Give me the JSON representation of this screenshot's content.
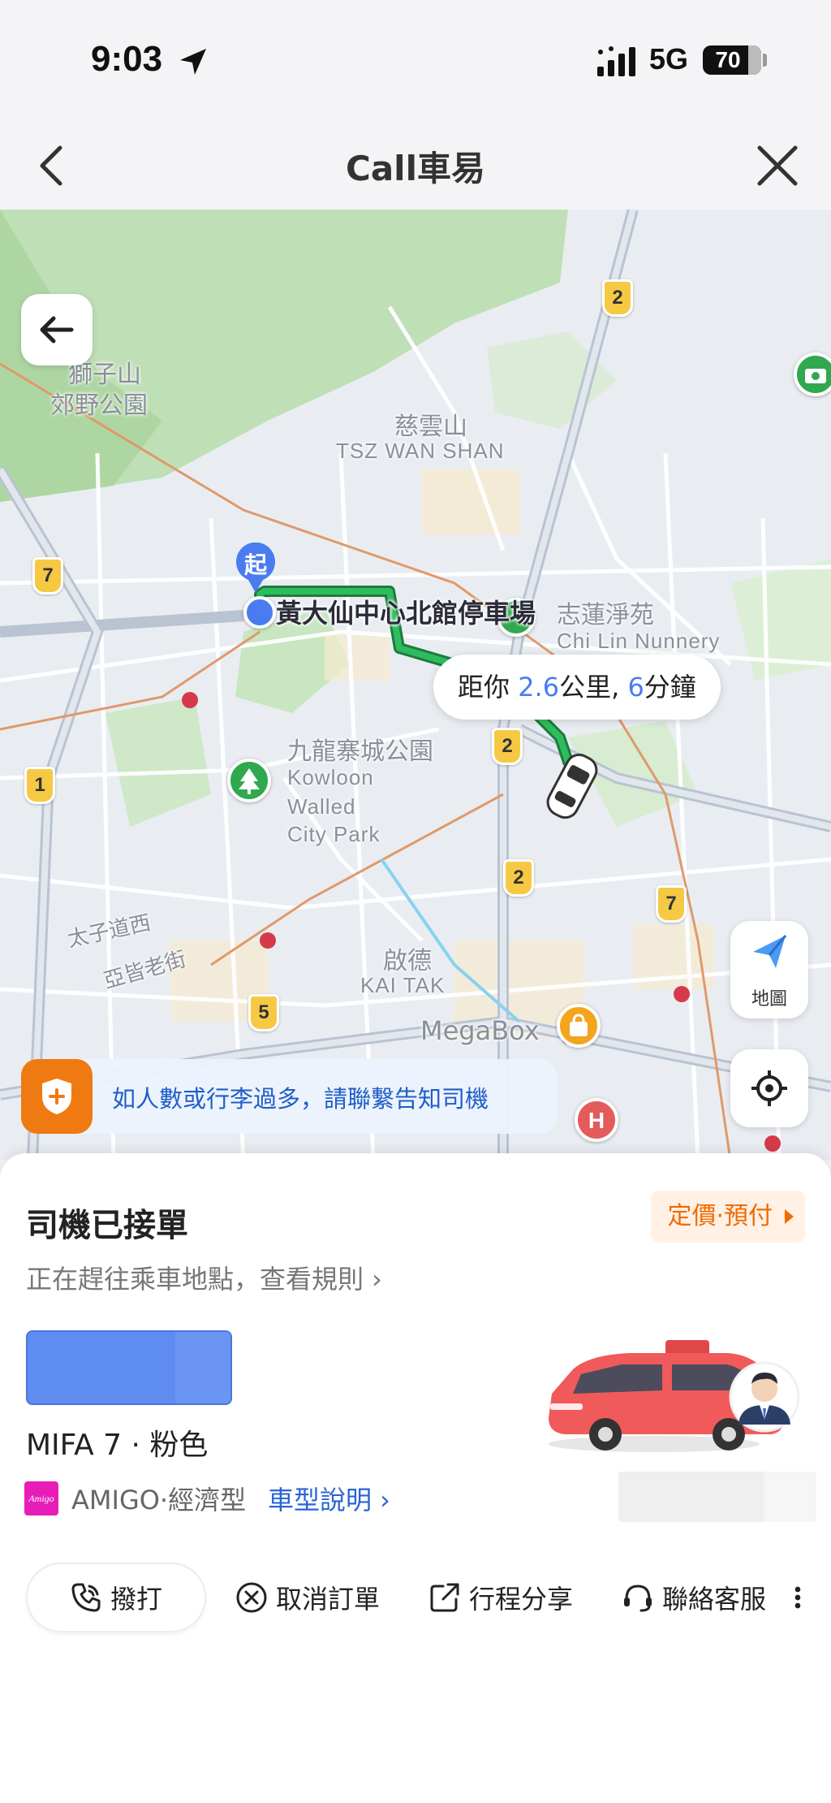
{
  "status_bar": {
    "time": "9:03",
    "network": "5G",
    "battery": "70"
  },
  "nav": {
    "title": "Call車易"
  },
  "map": {
    "labels": {
      "park1": "獅子山",
      "park2": "郊野公園",
      "area_zh": "慈雲山",
      "area_en": "TSZ WAN SHAN",
      "nunnery_zh": "志蓮淨苑",
      "nunnery_en": "Chi Lin Nunnery",
      "kw_zh": "九龍寨城公園",
      "kw_en1": "Kowloon",
      "kw_en2": "Walled",
      "kw_en3": "City Park",
      "road1": "太子道西",
      "road2": "亞皆老街",
      "kt_zh": "啟德",
      "kt_en": "KAI TAK",
      "megabox": "MegaBox"
    },
    "shields": [
      "2",
      "7",
      "1",
      "2",
      "2",
      "7",
      "5"
    ],
    "start_pin": "起",
    "start_name": "黃大仙中心北館停車場",
    "distance": {
      "prefix": "距你 ",
      "km": "2.6",
      "mid": "公里, ",
      "min": "6",
      "suffix": "分鐘"
    },
    "map_button_label": "地圖",
    "notice": "如人數或行李過多，請聯繫告知司機"
  },
  "sheet": {
    "title": "司機已接單",
    "price_tag": "定價·預付",
    "subtitle": "正在趕往乘車地點，查看規則 ›",
    "vehicle": "MIFA 7 · 粉色",
    "brand_logo": "Amigo",
    "brand_text": "AMIGO·經濟型",
    "brand_link": "車型說明 ›",
    "actions": {
      "call": "撥打",
      "cancel": "取消訂單",
      "share": "行程分享",
      "support": "聯絡客服"
    }
  },
  "colors": {
    "accent_blue": "#4a7cf0",
    "route_green": "#17a34a",
    "warning_orange": "#f07a12",
    "price_orange": "#f06a00"
  },
  "icons": [
    "location-arrow-icon",
    "signal-icon",
    "back-chevron-icon",
    "close-icon",
    "arrow-left-icon",
    "car-icon",
    "tree-icon",
    "shopping-bag-icon",
    "hospital-icon",
    "camera-icon",
    "paper-plane-icon",
    "locate-icon",
    "shield-plus-icon",
    "phone-icon",
    "cancel-circle-icon",
    "share-icon",
    "headset-icon",
    "more-vertical-icon"
  ]
}
